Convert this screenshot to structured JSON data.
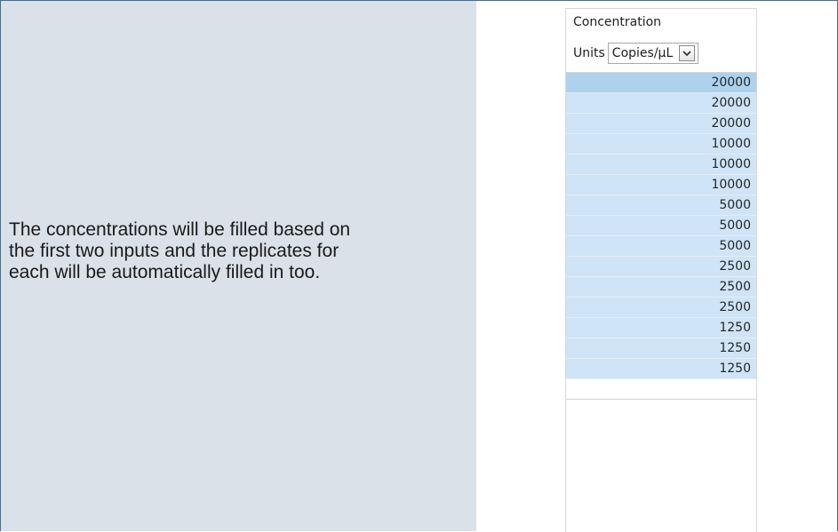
{
  "note": {
    "lines": [
      "The concentrations will be filled based on",
      "the first two inputs and the replicates for",
      "each will be automatically filled in too."
    ]
  },
  "grid": {
    "header_title": "Concentration",
    "units_label": "Units",
    "units_value": "Copies/µL",
    "rows": [
      "20000",
      "20000",
      "20000",
      "10000",
      "10000",
      "10000",
      "5000",
      "5000",
      "5000",
      "2500",
      "2500",
      "2500",
      "1250",
      "1250",
      "1250",
      ""
    ]
  },
  "colors": {
    "note_bg": "#dae1e8",
    "row_fill": "#cfe4f6",
    "row_active": "#aed2ee",
    "frame_border": "#4f6b86"
  },
  "icons": {
    "dropdown": "chevron-down-icon"
  }
}
